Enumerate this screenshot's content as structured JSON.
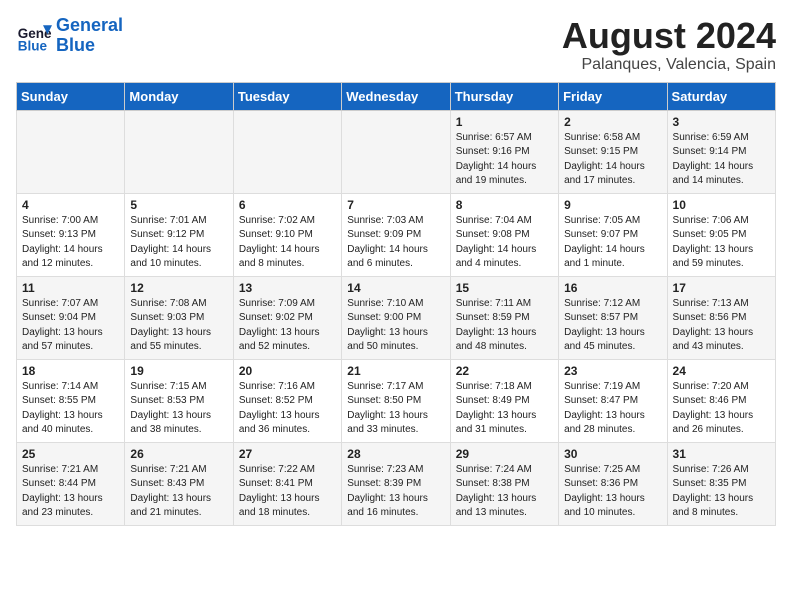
{
  "header": {
    "logo_line1": "General",
    "logo_line2": "Blue",
    "title": "August 2024",
    "subtitle": "Palanques, Valencia, Spain"
  },
  "weekdays": [
    "Sunday",
    "Monday",
    "Tuesday",
    "Wednesday",
    "Thursday",
    "Friday",
    "Saturday"
  ],
  "weeks": [
    [
      {
        "num": "",
        "info": ""
      },
      {
        "num": "",
        "info": ""
      },
      {
        "num": "",
        "info": ""
      },
      {
        "num": "",
        "info": ""
      },
      {
        "num": "1",
        "info": "Sunrise: 6:57 AM\nSunset: 9:16 PM\nDaylight: 14 hours\nand 19 minutes."
      },
      {
        "num": "2",
        "info": "Sunrise: 6:58 AM\nSunset: 9:15 PM\nDaylight: 14 hours\nand 17 minutes."
      },
      {
        "num": "3",
        "info": "Sunrise: 6:59 AM\nSunset: 9:14 PM\nDaylight: 14 hours\nand 14 minutes."
      }
    ],
    [
      {
        "num": "4",
        "info": "Sunrise: 7:00 AM\nSunset: 9:13 PM\nDaylight: 14 hours\nand 12 minutes."
      },
      {
        "num": "5",
        "info": "Sunrise: 7:01 AM\nSunset: 9:12 PM\nDaylight: 14 hours\nand 10 minutes."
      },
      {
        "num": "6",
        "info": "Sunrise: 7:02 AM\nSunset: 9:10 PM\nDaylight: 14 hours\nand 8 minutes."
      },
      {
        "num": "7",
        "info": "Sunrise: 7:03 AM\nSunset: 9:09 PM\nDaylight: 14 hours\nand 6 minutes."
      },
      {
        "num": "8",
        "info": "Sunrise: 7:04 AM\nSunset: 9:08 PM\nDaylight: 14 hours\nand 4 minutes."
      },
      {
        "num": "9",
        "info": "Sunrise: 7:05 AM\nSunset: 9:07 PM\nDaylight: 14 hours\nand 1 minute."
      },
      {
        "num": "10",
        "info": "Sunrise: 7:06 AM\nSunset: 9:05 PM\nDaylight: 13 hours\nand 59 minutes."
      }
    ],
    [
      {
        "num": "11",
        "info": "Sunrise: 7:07 AM\nSunset: 9:04 PM\nDaylight: 13 hours\nand 57 minutes."
      },
      {
        "num": "12",
        "info": "Sunrise: 7:08 AM\nSunset: 9:03 PM\nDaylight: 13 hours\nand 55 minutes."
      },
      {
        "num": "13",
        "info": "Sunrise: 7:09 AM\nSunset: 9:02 PM\nDaylight: 13 hours\nand 52 minutes."
      },
      {
        "num": "14",
        "info": "Sunrise: 7:10 AM\nSunset: 9:00 PM\nDaylight: 13 hours\nand 50 minutes."
      },
      {
        "num": "15",
        "info": "Sunrise: 7:11 AM\nSunset: 8:59 PM\nDaylight: 13 hours\nand 48 minutes."
      },
      {
        "num": "16",
        "info": "Sunrise: 7:12 AM\nSunset: 8:57 PM\nDaylight: 13 hours\nand 45 minutes."
      },
      {
        "num": "17",
        "info": "Sunrise: 7:13 AM\nSunset: 8:56 PM\nDaylight: 13 hours\nand 43 minutes."
      }
    ],
    [
      {
        "num": "18",
        "info": "Sunrise: 7:14 AM\nSunset: 8:55 PM\nDaylight: 13 hours\nand 40 minutes."
      },
      {
        "num": "19",
        "info": "Sunrise: 7:15 AM\nSunset: 8:53 PM\nDaylight: 13 hours\nand 38 minutes."
      },
      {
        "num": "20",
        "info": "Sunrise: 7:16 AM\nSunset: 8:52 PM\nDaylight: 13 hours\nand 36 minutes."
      },
      {
        "num": "21",
        "info": "Sunrise: 7:17 AM\nSunset: 8:50 PM\nDaylight: 13 hours\nand 33 minutes."
      },
      {
        "num": "22",
        "info": "Sunrise: 7:18 AM\nSunset: 8:49 PM\nDaylight: 13 hours\nand 31 minutes."
      },
      {
        "num": "23",
        "info": "Sunrise: 7:19 AM\nSunset: 8:47 PM\nDaylight: 13 hours\nand 28 minutes."
      },
      {
        "num": "24",
        "info": "Sunrise: 7:20 AM\nSunset: 8:46 PM\nDaylight: 13 hours\nand 26 minutes."
      }
    ],
    [
      {
        "num": "25",
        "info": "Sunrise: 7:21 AM\nSunset: 8:44 PM\nDaylight: 13 hours\nand 23 minutes."
      },
      {
        "num": "26",
        "info": "Sunrise: 7:21 AM\nSunset: 8:43 PM\nDaylight: 13 hours\nand 21 minutes."
      },
      {
        "num": "27",
        "info": "Sunrise: 7:22 AM\nSunset: 8:41 PM\nDaylight: 13 hours\nand 18 minutes."
      },
      {
        "num": "28",
        "info": "Sunrise: 7:23 AM\nSunset: 8:39 PM\nDaylight: 13 hours\nand 16 minutes."
      },
      {
        "num": "29",
        "info": "Sunrise: 7:24 AM\nSunset: 8:38 PM\nDaylight: 13 hours\nand 13 minutes."
      },
      {
        "num": "30",
        "info": "Sunrise: 7:25 AM\nSunset: 8:36 PM\nDaylight: 13 hours\nand 10 minutes."
      },
      {
        "num": "31",
        "info": "Sunrise: 7:26 AM\nSunset: 8:35 PM\nDaylight: 13 hours\nand 8 minutes."
      }
    ]
  ]
}
